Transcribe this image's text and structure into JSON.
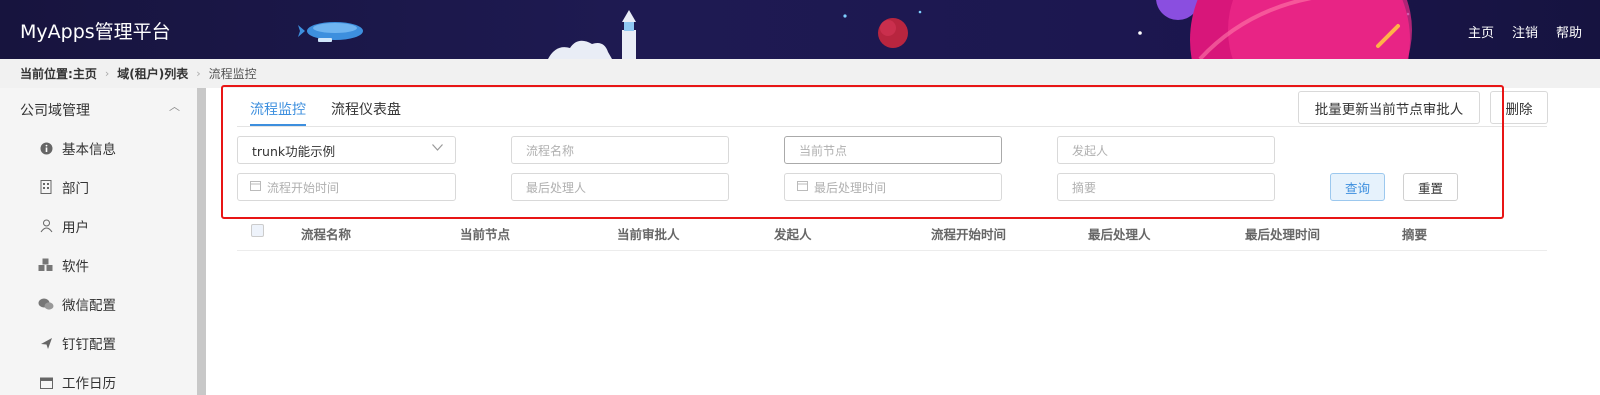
{
  "header": {
    "brand": "MyApps管理平台",
    "links": [
      "主页",
      "注销",
      "帮助"
    ]
  },
  "breadcrumb": {
    "label": "当前位置:",
    "items": [
      "主页",
      "域(租户)列表",
      "流程监控"
    ]
  },
  "sidebar": {
    "section": "公司域管理",
    "items": [
      {
        "label": "基本信息",
        "icon": "info-icon"
      },
      {
        "label": "部门",
        "icon": "building-icon"
      },
      {
        "label": "用户",
        "icon": "user-icon"
      },
      {
        "label": "软件",
        "icon": "cubes-icon"
      },
      {
        "label": "微信配置",
        "icon": "wechat-icon"
      },
      {
        "label": "钉钉配置",
        "icon": "dingtalk-icon"
      },
      {
        "label": "工作日历",
        "icon": "calendar-icon"
      }
    ]
  },
  "tabs": [
    {
      "label": "流程监控",
      "active": true
    },
    {
      "label": "流程仪表盘",
      "active": false
    }
  ],
  "actions": {
    "batch_update": "批量更新当前节点审批人",
    "delete": "删除"
  },
  "filters": {
    "app_select": "trunk功能示例",
    "flow_name": "流程名称",
    "current_node": "当前节点",
    "initiator": "发起人",
    "start_time": "流程开始时间",
    "last_handler": "最后处理人",
    "last_handle_time": "最后处理时间",
    "summary": "摘要",
    "query": "查询",
    "reset": "重置"
  },
  "table": {
    "columns": [
      "流程名称",
      "当前节点",
      "当前审批人",
      "发起人",
      "流程开始时间",
      "最后处理人",
      "最后处理时间",
      "摘要"
    ]
  },
  "colors": {
    "accent": "#3d8fde",
    "highlight": "#e81515",
    "header_bg": "#1c1850"
  }
}
